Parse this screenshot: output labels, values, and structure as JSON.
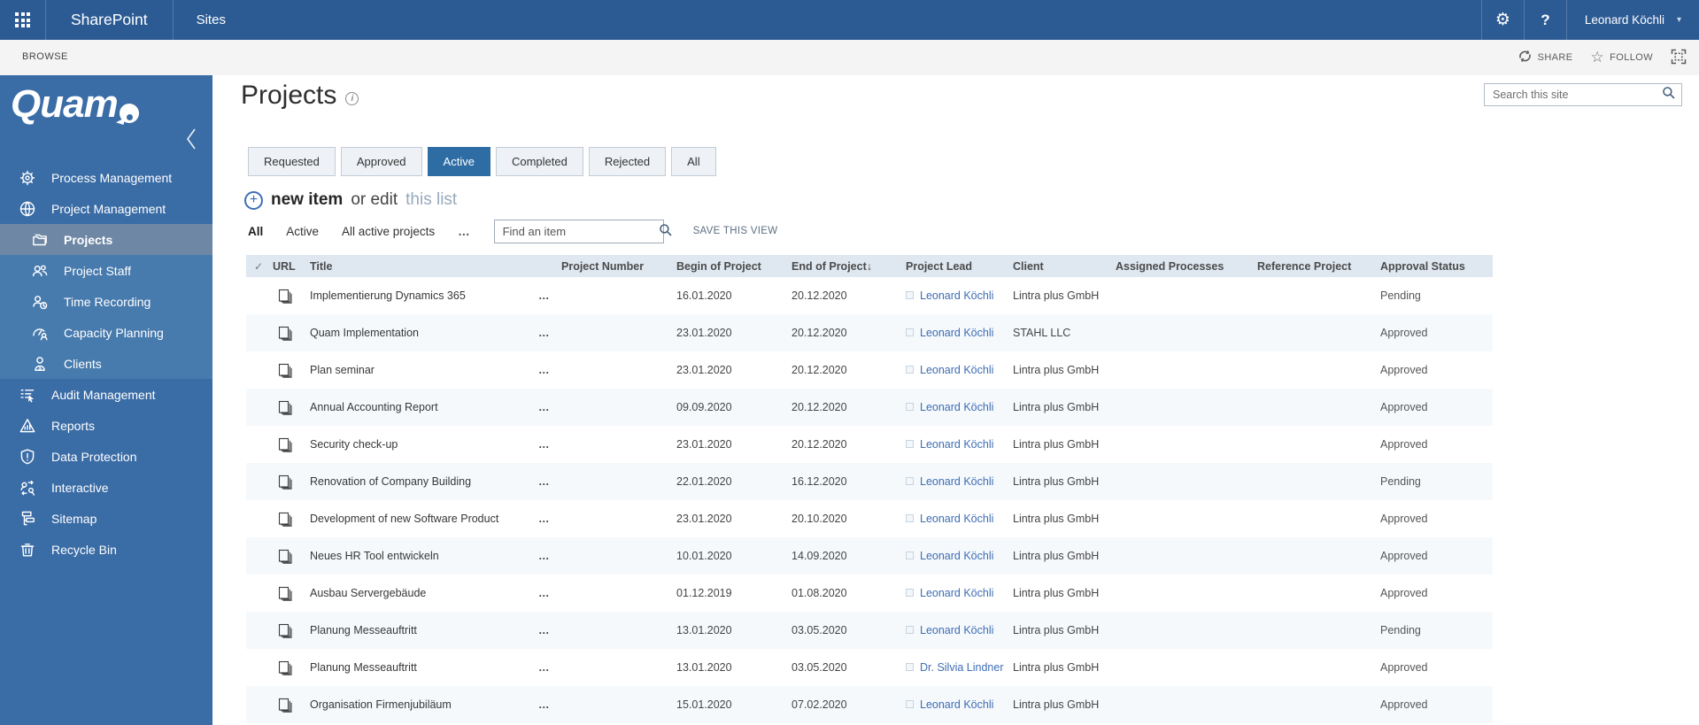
{
  "colors": {
    "topbar": "#2c5b94",
    "sidebar": "#3a6ca6",
    "accent": "#2e6da4",
    "link": "#3e6db5"
  },
  "topbar": {
    "brand": "SharePoint",
    "section": "Sites",
    "gear": "⚙",
    "help": "?",
    "user": "Leonard Köchli",
    "caret": "▾"
  },
  "ribbon": {
    "browse": "BROWSE",
    "share": "SHARE",
    "follow": "FOLLOW"
  },
  "logo": {
    "text": "Quam"
  },
  "sidebar": {
    "items": [
      {
        "label": "Process Management",
        "icon": "gear-icon"
      },
      {
        "label": "Project Management",
        "icon": "globe-icon"
      },
      {
        "label": "Projects",
        "icon": "folder-stack-icon",
        "sub": true,
        "active": true
      },
      {
        "label": "Project Staff",
        "icon": "people-group-icon",
        "sub": true
      },
      {
        "label": "Time Recording",
        "icon": "person-clock-icon",
        "sub": true
      },
      {
        "label": "Capacity Planning",
        "icon": "gauge-person-icon",
        "sub": true
      },
      {
        "label": "Clients",
        "icon": "person-dollar-icon",
        "sub": true
      },
      {
        "label": "Audit Management",
        "icon": "audit-list-icon"
      },
      {
        "label": "Reports",
        "icon": "report-triangle-icon"
      },
      {
        "label": "Data Protection",
        "icon": "shield-alert-icon"
      },
      {
        "label": "Interactive",
        "icon": "people-sync-icon"
      },
      {
        "label": "Sitemap",
        "icon": "sitemap-icon"
      },
      {
        "label": "Recycle Bin",
        "icon": "trash-icon"
      }
    ]
  },
  "page": {
    "title": "Projects"
  },
  "search": {
    "placeholder": "Search this site"
  },
  "filters": {
    "buttons": [
      "Requested",
      "Approved",
      "Active",
      "Completed",
      "Rejected",
      "All"
    ],
    "active": "Active"
  },
  "toolbar": {
    "new_item": "new item",
    "or_edit": "or edit",
    "this_list": "this list",
    "plus": "+"
  },
  "viewbar": {
    "views": [
      "All",
      "Active",
      "All active projects"
    ],
    "selected": "All",
    "more": "…",
    "find_placeholder": "Find an item",
    "save_view": "SAVE THIS VIEW"
  },
  "table": {
    "check_glyph": "✓",
    "ellipsis": "…",
    "columns": [
      {
        "label": "",
        "type": "check"
      },
      {
        "label": "URL"
      },
      {
        "label": "Title"
      },
      {
        "label": ""
      },
      {
        "label": "Project Number"
      },
      {
        "label": "Begin of Project"
      },
      {
        "label": "End of Project",
        "sort": "↓"
      },
      {
        "label": "Project Lead"
      },
      {
        "label": "Client"
      },
      {
        "label": "Assigned Processes"
      },
      {
        "label": "Reference Project"
      },
      {
        "label": "Approval Status"
      }
    ],
    "rows": [
      {
        "title": "Implementierung Dynamics 365",
        "project_number": "",
        "begin": "16.01.2020",
        "end": "20.12.2020",
        "lead": "Leonard Köchli",
        "client": "Lintra plus GmbH",
        "assigned": "",
        "reference": "",
        "status": "Pending"
      },
      {
        "title": "Quam Implementation",
        "project_number": "",
        "begin": "23.01.2020",
        "end": "20.12.2020",
        "lead": "Leonard Köchli",
        "client": "STAHL LLC",
        "assigned": "",
        "reference": "",
        "status": "Approved"
      },
      {
        "title": "Plan seminar",
        "project_number": "",
        "begin": "23.01.2020",
        "end": "20.12.2020",
        "lead": "Leonard Köchli",
        "client": "Lintra plus GmbH",
        "assigned": "",
        "reference": "",
        "status": "Approved"
      },
      {
        "title": "Annual Accounting Report",
        "project_number": "",
        "begin": "09.09.2020",
        "end": "20.12.2020",
        "lead": "Leonard Köchli",
        "client": "Lintra plus GmbH",
        "assigned": "",
        "reference": "",
        "status": "Approved"
      },
      {
        "title": "Security check-up",
        "project_number": "",
        "begin": "23.01.2020",
        "end": "20.12.2020",
        "lead": "Leonard Köchli",
        "client": "Lintra plus GmbH",
        "assigned": "",
        "reference": "",
        "status": "Approved"
      },
      {
        "title": "Renovation of Company Building",
        "project_number": "",
        "begin": "22.01.2020",
        "end": "16.12.2020",
        "lead": "Leonard Köchli",
        "client": "Lintra plus GmbH",
        "assigned": "",
        "reference": "",
        "status": "Pending"
      },
      {
        "title": "Development of new Software Product",
        "project_number": "",
        "begin": "23.01.2020",
        "end": "20.10.2020",
        "lead": "Leonard Köchli",
        "client": "Lintra plus GmbH",
        "assigned": "",
        "reference": "",
        "status": "Approved"
      },
      {
        "title": "Neues HR Tool entwickeln",
        "project_number": "",
        "begin": "10.01.2020",
        "end": "14.09.2020",
        "lead": "Leonard Köchli",
        "client": "Lintra plus GmbH",
        "assigned": "",
        "reference": "",
        "status": "Approved"
      },
      {
        "title": "Ausbau Servergebäude",
        "project_number": "",
        "begin": "01.12.2019",
        "end": "01.08.2020",
        "lead": "Leonard Köchli",
        "client": "Lintra plus GmbH",
        "assigned": "",
        "reference": "",
        "status": "Approved"
      },
      {
        "title": "Planung Messeauftritt",
        "project_number": "",
        "begin": "13.01.2020",
        "end": "03.05.2020",
        "lead": "Leonard Köchli",
        "client": "Lintra plus GmbH",
        "assigned": "",
        "reference": "",
        "status": "Pending"
      },
      {
        "title": "Planung Messeauftritt",
        "project_number": "",
        "begin": "13.01.2020",
        "end": "03.05.2020",
        "lead": "Dr. Silvia Lindner",
        "client": "Lintra plus GmbH",
        "assigned": "",
        "reference": "",
        "status": "Approved"
      },
      {
        "title": "Organisation Firmenjubiläum",
        "project_number": "",
        "begin": "15.01.2020",
        "end": "07.02.2020",
        "lead": "Leonard Köchli",
        "client": "Lintra plus GmbH",
        "assigned": "",
        "reference": "",
        "status": "Approved"
      }
    ]
  }
}
